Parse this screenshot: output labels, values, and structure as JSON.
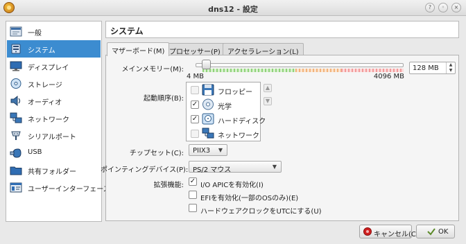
{
  "window": {
    "title": "dns12 - 設定"
  },
  "sidebar": {
    "items": [
      {
        "label": "一般",
        "icon": "general-icon"
      },
      {
        "label": "システム",
        "icon": "system-icon",
        "selected": true
      },
      {
        "label": "ディスプレイ",
        "icon": "display-icon"
      },
      {
        "label": "ストレージ",
        "icon": "storage-icon"
      },
      {
        "label": "オーディオ",
        "icon": "audio-icon"
      },
      {
        "label": "ネットワーク",
        "icon": "network-icon"
      },
      {
        "label": "シリアルポート",
        "icon": "serial-port-icon"
      },
      {
        "label": "USB",
        "icon": "usb-icon"
      },
      {
        "label": "共有フォルダー",
        "icon": "shared-folder-icon"
      },
      {
        "label": "ユーザーインターフェース",
        "icon": "user-interface-icon"
      }
    ]
  },
  "header": {
    "title": "システム"
  },
  "tabs": [
    {
      "label": "マザーボード(M)",
      "active": true
    },
    {
      "label": "プロセッサー(P)"
    },
    {
      "label": "アクセラレーション(L)"
    }
  ],
  "memory": {
    "label": "メインメモリー(M):",
    "min_label": "4 MB",
    "max_label": "4096 MB",
    "value": "128 MB",
    "slider_fraction": 0.03
  },
  "boot_order": {
    "label": "起動順序(B):",
    "items": [
      {
        "label": "フロッピー",
        "checked": false,
        "icon": "floppy-icon"
      },
      {
        "label": "光学",
        "checked": true,
        "icon": "optical-disc-icon"
      },
      {
        "label": "ハードディスク",
        "checked": true,
        "icon": "hard-disk-icon"
      },
      {
        "label": "ネットワーク",
        "checked": false,
        "icon": "network-boot-icon"
      }
    ]
  },
  "chipset": {
    "label": "チップセット(C):",
    "value": "PIIX3"
  },
  "pointing": {
    "label": "ポインティングデバイス(P):",
    "value": "PS/2 マウス"
  },
  "features": {
    "label": "拡張機能:",
    "items": [
      {
        "label": "I/O APICを有効化(I)",
        "checked": true
      },
      {
        "label": "EFIを有効化(一部のOSのみ)(E)",
        "checked": false
      },
      {
        "label": "ハードウェアクロックをUTCにする(U)",
        "checked": false
      }
    ]
  },
  "buttons": {
    "cancel": "キャンセル(C)",
    "ok": "OK"
  },
  "colors": {
    "selection": "#3c8cd0",
    "cancel_icon": "#d02020",
    "ok_icon": "#5c8a2a"
  }
}
